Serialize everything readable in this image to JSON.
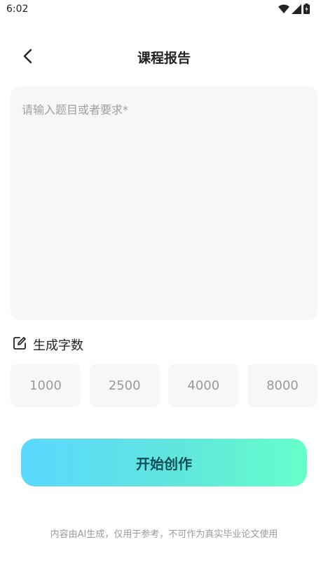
{
  "status_bar": {
    "time": "6:02",
    "icons": [
      "wifi-icon",
      "cellular-signal-icon",
      "battery-charging-icon"
    ]
  },
  "header": {
    "back_icon": "chevron-left-icon",
    "title": "课程报告"
  },
  "topic_input": {
    "value": "",
    "placeholder": "请输入题目或者要求*"
  },
  "word_count": {
    "icon": "edit-icon",
    "label": "生成字数",
    "options": [
      "1000",
      "2500",
      "4000",
      "8000"
    ]
  },
  "start_button": {
    "label": "开始创作",
    "gradient_start": "#5ad8ff",
    "gradient_end": "#66ffc9"
  },
  "disclaimer": "内容由AI生成，仅用于参考，不可作为真实毕业论文使用"
}
